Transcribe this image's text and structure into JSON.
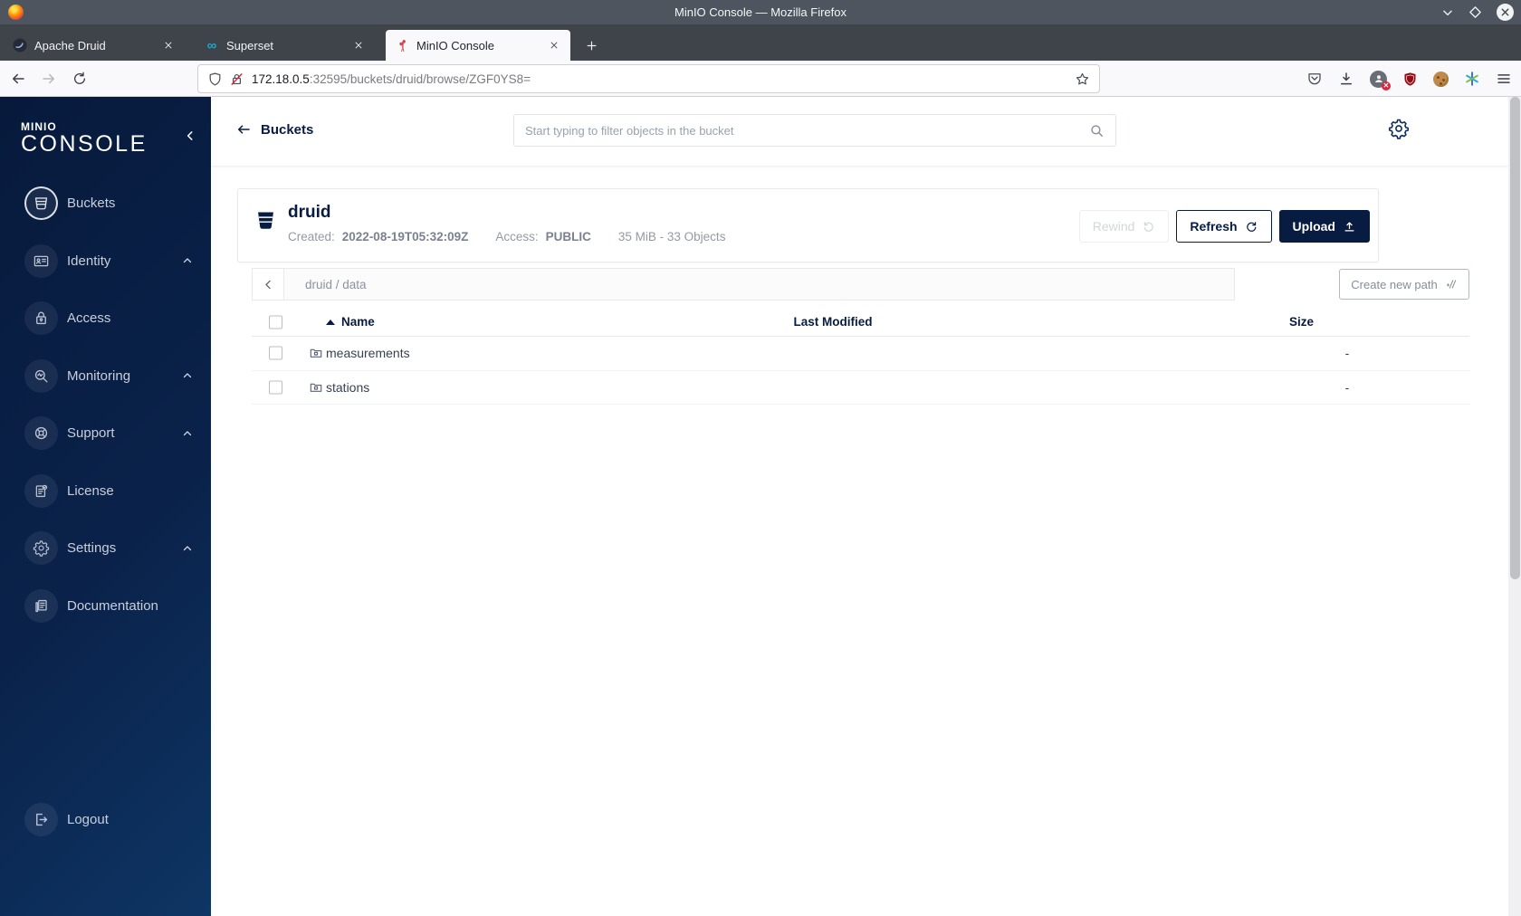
{
  "titlebar": {
    "title": "MinIO Console — Mozilla Firefox"
  },
  "tabs": [
    {
      "label": "Apache Druid"
    },
    {
      "label": "Superset"
    },
    {
      "label": "MinIO Console"
    }
  ],
  "urlbar": {
    "host": "172.18.0.5",
    "rest": ":32595/buckets/druid/browse/ZGF0YS8="
  },
  "sidebar": {
    "logo_line1": "MINIO",
    "logo_line2": "CONSOLE",
    "items": [
      {
        "label": "Buckets",
        "icon": "bucket-icon"
      },
      {
        "label": "Identity",
        "icon": "id-card-icon"
      },
      {
        "label": "Access",
        "icon": "lock-icon"
      },
      {
        "label": "Monitoring",
        "icon": "monitoring-icon"
      },
      {
        "label": "Support",
        "icon": "support-icon"
      },
      {
        "label": "License",
        "icon": "license-icon"
      },
      {
        "label": "Settings",
        "icon": "gear-icon"
      },
      {
        "label": "Documentation",
        "icon": "documentation-icon"
      }
    ],
    "logout_label": "Logout"
  },
  "header": {
    "back_label": "Buckets",
    "search_placeholder": "Start typing to filter objects in the bucket"
  },
  "bucket": {
    "name": "druid",
    "created_label": "Created:",
    "created_value": "2022-08-19T05:32:09Z",
    "access_label": "Access:",
    "access_value": "PUBLIC",
    "summary": "35 MiB - 33 Objects",
    "rewind_label": "Rewind",
    "refresh_label": "Refresh",
    "upload_label": "Upload"
  },
  "pathbar": {
    "breadcrumb": "druid / data",
    "create_label": "Create new path"
  },
  "table": {
    "col_name": "Name",
    "col_modified": "Last Modified",
    "col_size": "Size",
    "rows": [
      {
        "name": "measurements",
        "size": "-"
      },
      {
        "name": "stations",
        "size": "-"
      }
    ]
  }
}
